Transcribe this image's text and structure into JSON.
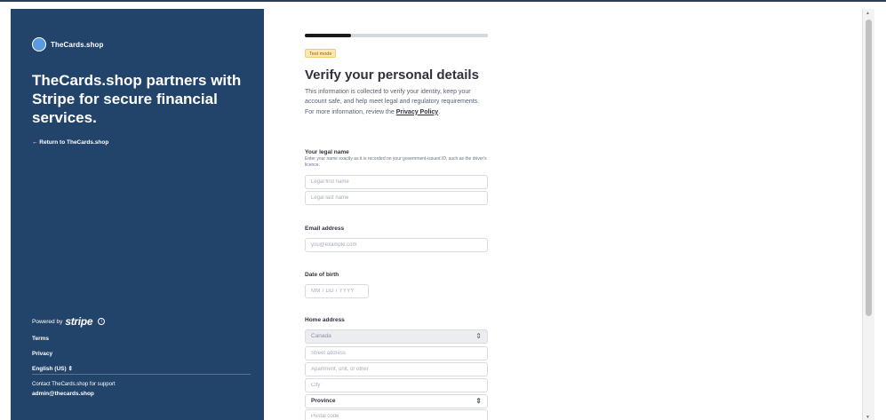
{
  "sidebar": {
    "brand": "TheCards.shop",
    "headline": "TheCards.shop partners with Stripe for secure financial services.",
    "return_link": "← Return to TheCards.shop",
    "powered_by": "Powered by",
    "stripe": "stripe",
    "terms": "Terms",
    "privacy": "Privacy",
    "language": "English (US)",
    "support_text": "Contact TheCards.shop for support",
    "support_email": "admin@thecards.shop"
  },
  "form": {
    "progress": 0.25,
    "badge": "Test mode",
    "title": "Verify your personal details",
    "intro": "This information is collected to verify your identity, keep your account safe, and help meet legal and regulatory requirements. For more information, review the ",
    "intro_link": "Privacy Policy",
    "intro_end": ".",
    "legal_name": {
      "label": "Your legal name",
      "help": "Enter your name exactly as it is recorded on your government-issued ID, such as the driver's licence.",
      "first_placeholder": "Legal first name",
      "last_placeholder": "Legal last name"
    },
    "email": {
      "label": "Email address",
      "placeholder": "you@example.com"
    },
    "dob": {
      "label": "Date of birth",
      "placeholder": "MM / DD / YYYY"
    },
    "address": {
      "label": "Home address",
      "country": "Canada",
      "street_placeholder": "Street address",
      "apt_placeholder": "Apartment, unit, or other",
      "city_placeholder": "City",
      "province": "Province",
      "postal_placeholder": "Postal code"
    }
  },
  "colors": {
    "sidebar_bg": "#22446b",
    "badge_bg": "#fde9b4",
    "badge_text": "#a45b0b"
  }
}
